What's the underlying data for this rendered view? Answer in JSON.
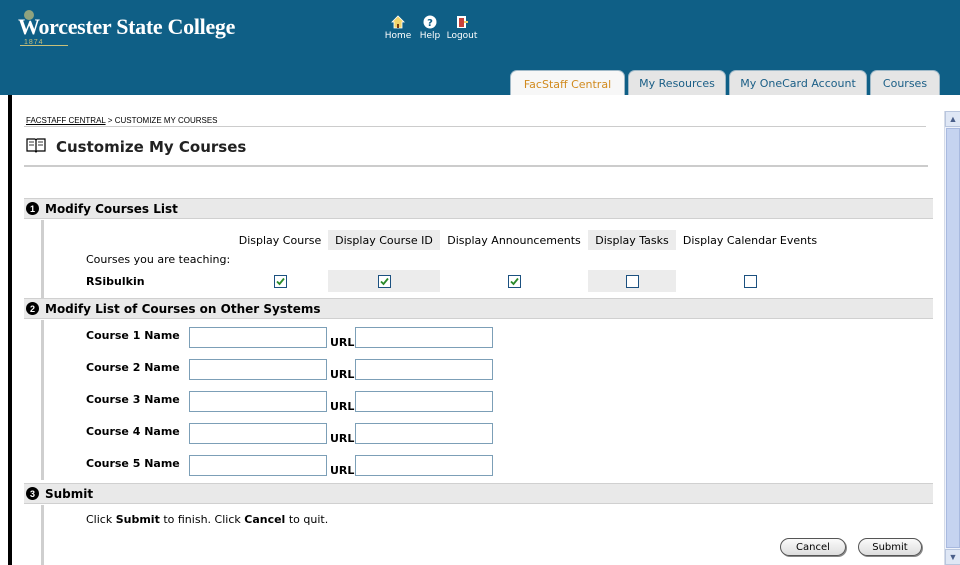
{
  "header": {
    "logo_text": "Worcester State College",
    "logo_sub": "1874",
    "nav": [
      {
        "label": "Home",
        "icon": "home-icon"
      },
      {
        "label": "Help",
        "icon": "help-icon"
      },
      {
        "label": "Logout",
        "icon": "logout-icon"
      }
    ]
  },
  "tabs": [
    {
      "label": "FacStaff Central",
      "active": true
    },
    {
      "label": "My Resources",
      "active": false
    },
    {
      "label": "My OneCard Account",
      "active": false
    },
    {
      "label": "Courses",
      "active": false
    }
  ],
  "breadcrumb": {
    "link": "FACSTAFF CENTRAL",
    "separator": " > ",
    "current": "CUSTOMIZE MY COURSES"
  },
  "page_title": "Customize My Courses",
  "section1": {
    "number": "1",
    "title": "Modify Courses List",
    "columns": [
      "Display Course",
      "Display Course ID",
      "Display Announcements",
      "Display Tasks",
      "Display Calendar Events"
    ],
    "teaching_label": "Courses you are teaching:",
    "course_name": "RSibulkin",
    "checks": [
      true,
      true,
      true,
      false,
      false
    ]
  },
  "section2": {
    "number": "2",
    "title": "Modify List of Courses on Other Systems",
    "url_label": "URL",
    "rows": [
      {
        "label": "Course 1 Name",
        "name_value": "",
        "url_value": ""
      },
      {
        "label": "Course 2 Name",
        "name_value": "",
        "url_value": ""
      },
      {
        "label": "Course 3 Name",
        "name_value": "",
        "url_value": ""
      },
      {
        "label": "Course 4 Name",
        "name_value": "",
        "url_value": ""
      },
      {
        "label": "Course 5 Name",
        "name_value": "",
        "url_value": ""
      }
    ]
  },
  "section3": {
    "number": "3",
    "title": "Submit",
    "instr_1": "Click ",
    "instr_submit": "Submit",
    "instr_2": " to finish. Click ",
    "instr_cancel": "Cancel",
    "instr_3": " to quit."
  },
  "buttons": {
    "cancel": "Cancel",
    "submit": "Submit"
  },
  "colors": {
    "header_bg": "#0f5f86",
    "active_tab_text": "#d18a1e",
    "tab_text": "#1a5e86",
    "section_bg": "#e9e9e9"
  }
}
